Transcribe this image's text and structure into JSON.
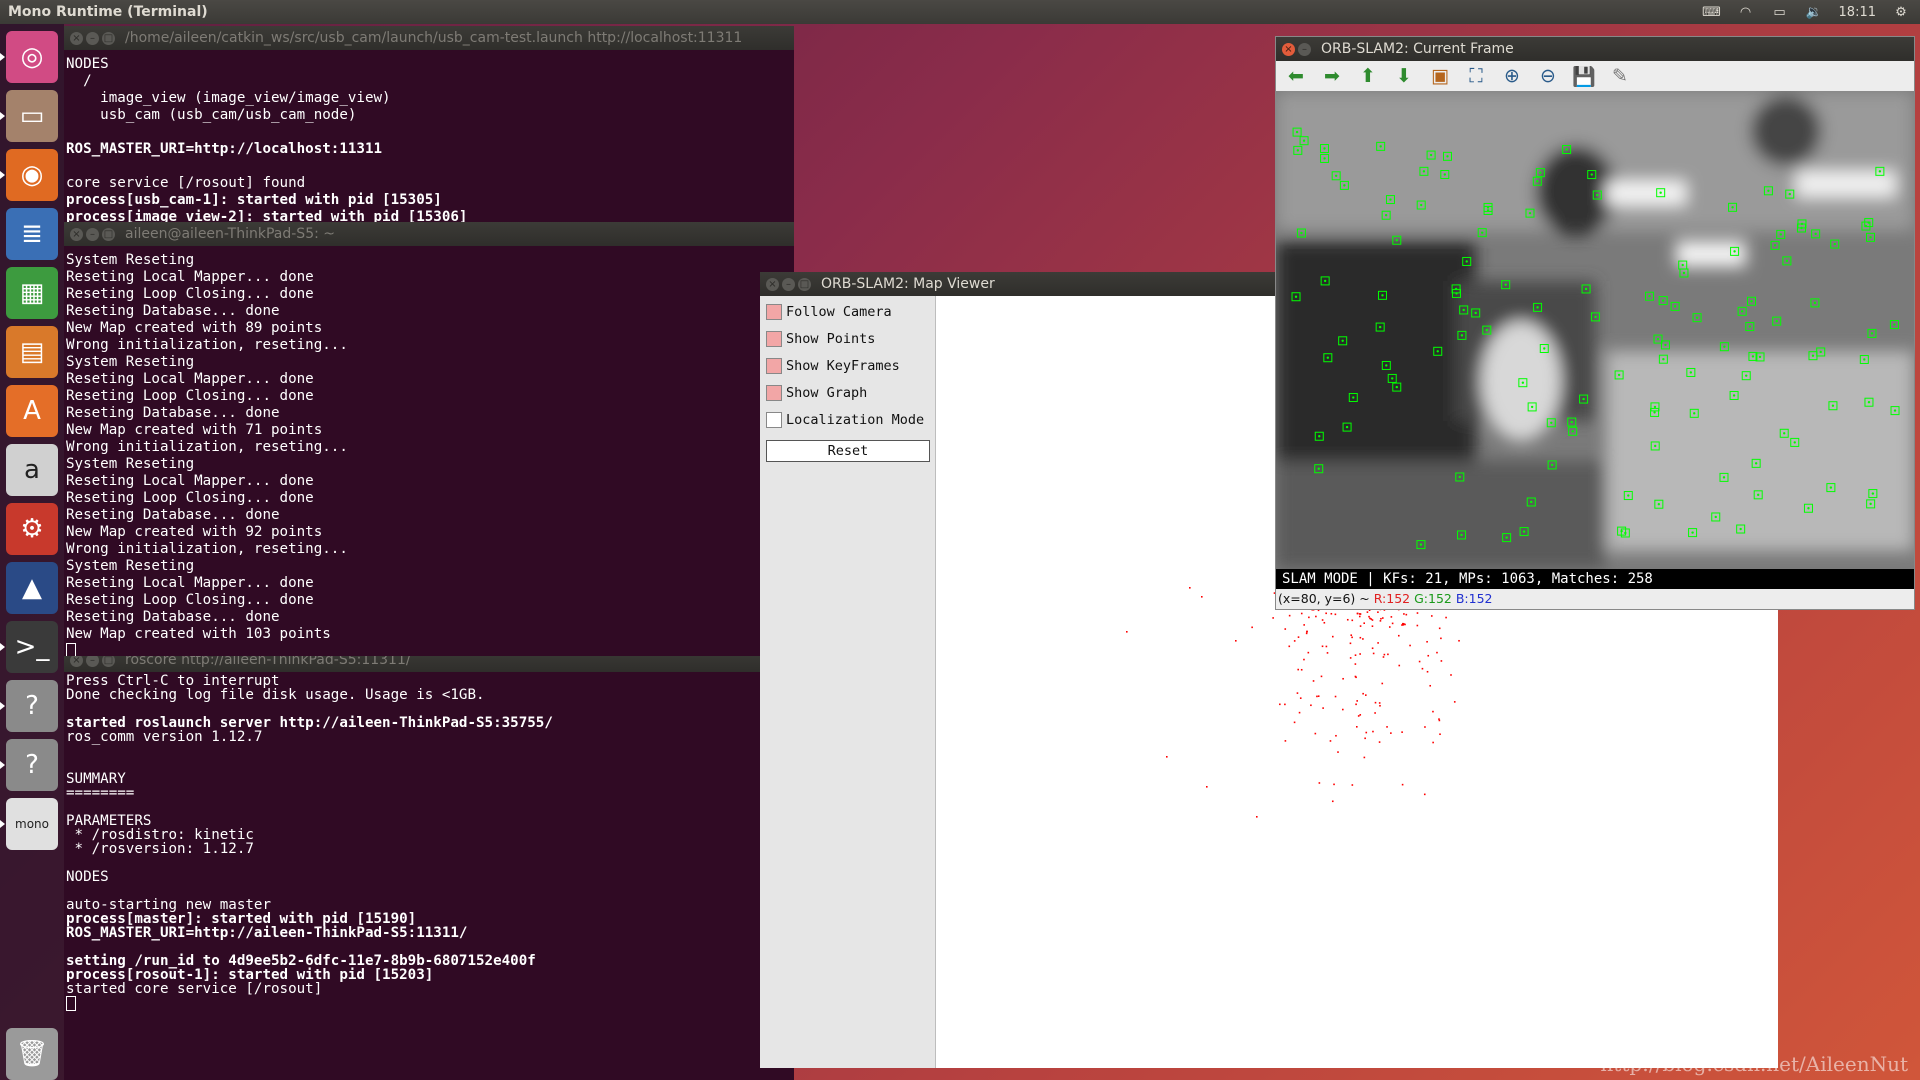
{
  "topbar": {
    "title": "Mono Runtime (Terminal)",
    "clock": "18:11"
  },
  "launcher": {
    "items": [
      {
        "name": "ubuntu-dash-icon",
        "glyph": "◎",
        "bg": "#d14b84"
      },
      {
        "name": "files-icon",
        "glyph": "▭",
        "bg": "#a4826b"
      },
      {
        "name": "firefox-icon",
        "glyph": "◉",
        "bg": "#e06a22"
      },
      {
        "name": "writer-icon",
        "glyph": "≣",
        "bg": "#3a6fb5"
      },
      {
        "name": "calc-icon",
        "glyph": "▦",
        "bg": "#3d9b3f"
      },
      {
        "name": "impress-icon",
        "glyph": "▤",
        "bg": "#d9792a"
      },
      {
        "name": "software-center-icon",
        "glyph": "A",
        "bg": "#e46e28"
      },
      {
        "name": "amazon-icon",
        "glyph": "a",
        "bg": "#d0d0d0"
      },
      {
        "name": "settings-icon",
        "glyph": "⚙",
        "bg": "#c8392c"
      },
      {
        "name": "cmake-icon",
        "glyph": "▲",
        "bg": "#2a4a86"
      },
      {
        "name": "terminal-icon",
        "glyph": ">_",
        "bg": "#3a3a3a"
      },
      {
        "name": "unknown-app-icon",
        "glyph": "?",
        "bg": "#8a8a8a"
      },
      {
        "name": "unknown-app-icon",
        "glyph": "?",
        "bg": "#8a8a8a"
      },
      {
        "name": "mono-icon",
        "glyph": "mono",
        "bg": "#e0e0e0"
      },
      {
        "name": "trash-icon",
        "glyph": "🗑",
        "bg": "#9a9a9a"
      }
    ]
  },
  "term1": {
    "title": "/home/aileen/catkin_ws/src/usb_cam/launch/usb_cam-test.launch http://localhost:11311",
    "lines": [
      {
        "t": "NODES",
        "b": false
      },
      {
        "t": "  /",
        "b": false
      },
      {
        "t": "    image_view (image_view/image_view)",
        "b": false
      },
      {
        "t": "    usb_cam (usb_cam/usb_cam_node)",
        "b": false
      },
      {
        "t": "",
        "b": false
      },
      {
        "t": "ROS_MASTER_URI=http://localhost:11311",
        "b": true
      },
      {
        "t": "",
        "b": false
      },
      {
        "t": "core service [/rosout] found",
        "b": false
      },
      {
        "t": "process[usb_cam-1]: started with pid [15305]",
        "b": true
      },
      {
        "t": "process[image_view-2]: started with pid [15306]",
        "b": true
      }
    ]
  },
  "term2": {
    "title": "aileen@aileen-ThinkPad-S5: ~",
    "lines": [
      "System Reseting",
      "Reseting Local Mapper... done",
      "Reseting Loop Closing... done",
      "Reseting Database... done",
      "New Map created with 89 points",
      "Wrong initialization, reseting...",
      "System Reseting",
      "Reseting Local Mapper... done",
      "Reseting Loop Closing... done",
      "Reseting Database... done",
      "New Map created with 71 points",
      "Wrong initialization, reseting...",
      "System Reseting",
      "Reseting Local Mapper... done",
      "Reseting Loop Closing... done",
      "Reseting Database... done",
      "New Map created with 92 points",
      "Wrong initialization, reseting...",
      "System Reseting",
      "Reseting Local Mapper... done",
      "Reseting Loop Closing... done",
      "Reseting Database... done",
      "New Map created with 103 points"
    ]
  },
  "term3": {
    "title": "roscore http://aileen-ThinkPad-S5:11311/",
    "lines": [
      {
        "t": "Press Ctrl-C to interrupt",
        "b": false
      },
      {
        "t": "Done checking log file disk usage. Usage is <1GB.",
        "b": false
      },
      {
        "t": "",
        "b": false
      },
      {
        "t": "started roslaunch server http://aileen-ThinkPad-S5:35755/",
        "b": true
      },
      {
        "t": "ros_comm version 1.12.7",
        "b": false
      },
      {
        "t": "",
        "b": false
      },
      {
        "t": "",
        "b": false
      },
      {
        "t": "SUMMARY",
        "b": false
      },
      {
        "t": "========",
        "b": false
      },
      {
        "t": "",
        "b": false
      },
      {
        "t": "PARAMETERS",
        "b": false
      },
      {
        "t": " * /rosdistro: kinetic",
        "b": false
      },
      {
        "t": " * /rosversion: 1.12.7",
        "b": false
      },
      {
        "t": "",
        "b": false
      },
      {
        "t": "NODES",
        "b": false
      },
      {
        "t": "",
        "b": false
      },
      {
        "t": "auto-starting new master",
        "b": false
      },
      {
        "t": "process[master]: started with pid [15190]",
        "b": true
      },
      {
        "t": "ROS_MASTER_URI=http://aileen-ThinkPad-S5:11311/",
        "b": true
      },
      {
        "t": "",
        "b": false
      },
      {
        "t": "setting /run_id to 4d9ee5b2-6dfc-11e7-8b9b-6807152e400f",
        "b": true
      },
      {
        "t": "process[rosout-1]: started with pid [15203]",
        "b": true
      },
      {
        "t": "started core service [/rosout]",
        "b": false
      }
    ]
  },
  "mapviewer": {
    "title": "ORB-SLAM2: Map Viewer",
    "options": [
      {
        "label": "Follow Camera",
        "checked": true
      },
      {
        "label": "Show Points",
        "checked": true
      },
      {
        "label": "Show KeyFrames",
        "checked": true
      },
      {
        "label": "Show Graph",
        "checked": true
      },
      {
        "label": "Localization Mode",
        "checked": false
      }
    ],
    "reset_label": "Reset"
  },
  "curframe": {
    "title": "ORB-SLAM2: Current Frame",
    "status": "SLAM MODE |  KFs: 21, MPs: 1063, Matches: 258",
    "pixel_pos": "(x=80, y=6) ~ ",
    "pixel_r": "R:152",
    "pixel_g": "G:152",
    "pixel_b": "B:152",
    "toolbar": [
      "back-arrow-icon",
      "forward-arrow-icon",
      "up-arrow-icon",
      "down-arrow-icon",
      "image-icon",
      "zoom-fit-icon",
      "zoom-in-icon",
      "zoom-out-icon",
      "save-icon",
      "properties-icon"
    ],
    "colors": {
      "feature": "#00ff00",
      "map_point": "#ff0000",
      "keyframe": "#0000ff"
    }
  },
  "watermark": "http://blog.csdn.net/AileenNut"
}
